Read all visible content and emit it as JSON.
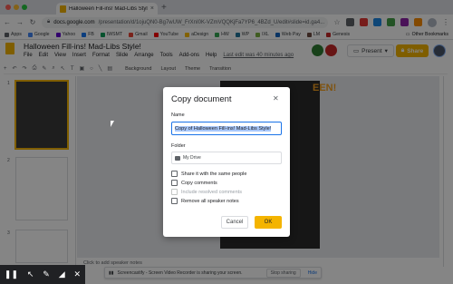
{
  "browser": {
    "tab_title": "Halloween Fill-ins! Mad-Libs Style!",
    "url_host": "docs.google.com",
    "url_path": "/presentation/d/1ojuQN0-Bg7wUW_FrXnI0K-VZmVQQKjFa7YP6_4BZd_U/edit#slide=id.ga4...",
    "bookmarks": [
      {
        "label": "Apps",
        "color": "#5f6368"
      },
      {
        "label": "Google",
        "color": "#4285f4"
      },
      {
        "label": "Yahoo",
        "color": "#6001d2"
      },
      {
        "label": "FB",
        "color": "#1877f2"
      },
      {
        "label": "IWSMT",
        "color": "#0f9d58"
      },
      {
        "label": "Gmail",
        "color": "#ea4335"
      },
      {
        "label": "YouTube",
        "color": "#ff0000"
      },
      {
        "label": "aDesign",
        "color": "#fbbc05"
      },
      {
        "label": "HW",
        "color": "#34a853"
      },
      {
        "label": "WP",
        "color": "#21759b"
      },
      {
        "label": "IXL",
        "color": "#7cb342"
      },
      {
        "label": "Web Pay",
        "color": "#1565c0"
      },
      {
        "label": "LM",
        "color": "#6d4c41"
      },
      {
        "label": "Genesis",
        "color": "#c62828"
      }
    ],
    "other_bookmarks": "Other Bookmarks"
  },
  "app": {
    "doc_title": "Halloween Fill-ins! Mad-Libs Style!",
    "menus": [
      "File",
      "Edit",
      "View",
      "Insert",
      "Format",
      "Slide",
      "Arrange",
      "Tools",
      "Add-ons",
      "Help"
    ],
    "last_edit": "Last edit was 40 minutes ago",
    "present_label": "Present",
    "share_label": "Share",
    "toolbar": [
      "Background",
      "Layout",
      "Theme",
      "Transition"
    ],
    "speaker_notes": "Click to add speaker notes",
    "slide_numbers": [
      "1",
      "2",
      "3"
    ],
    "slide_text": "EEN!"
  },
  "dialog": {
    "title": "Copy document",
    "name_label": "Name",
    "name_value": "Copy of Halloween Fill-ins! Mad-Libs Style!",
    "folder_label": "Folder",
    "folder_value": "My Drive",
    "options": {
      "share": "Share it with the same people",
      "comments": "Copy comments",
      "resolved": "Include resolved comments",
      "speaker": "Remove all speaker notes"
    },
    "cancel_label": "Cancel",
    "ok_label": "OK"
  },
  "screencastify": {
    "message": "Screencastify - Screen Video Recorder is sharing your screen.",
    "stop_label": "Stop sharing",
    "hide_label": "Hide"
  },
  "colors": {
    "accent": "#f4b400",
    "selection": "#a8c7fa",
    "focus": "#1a73e8"
  }
}
